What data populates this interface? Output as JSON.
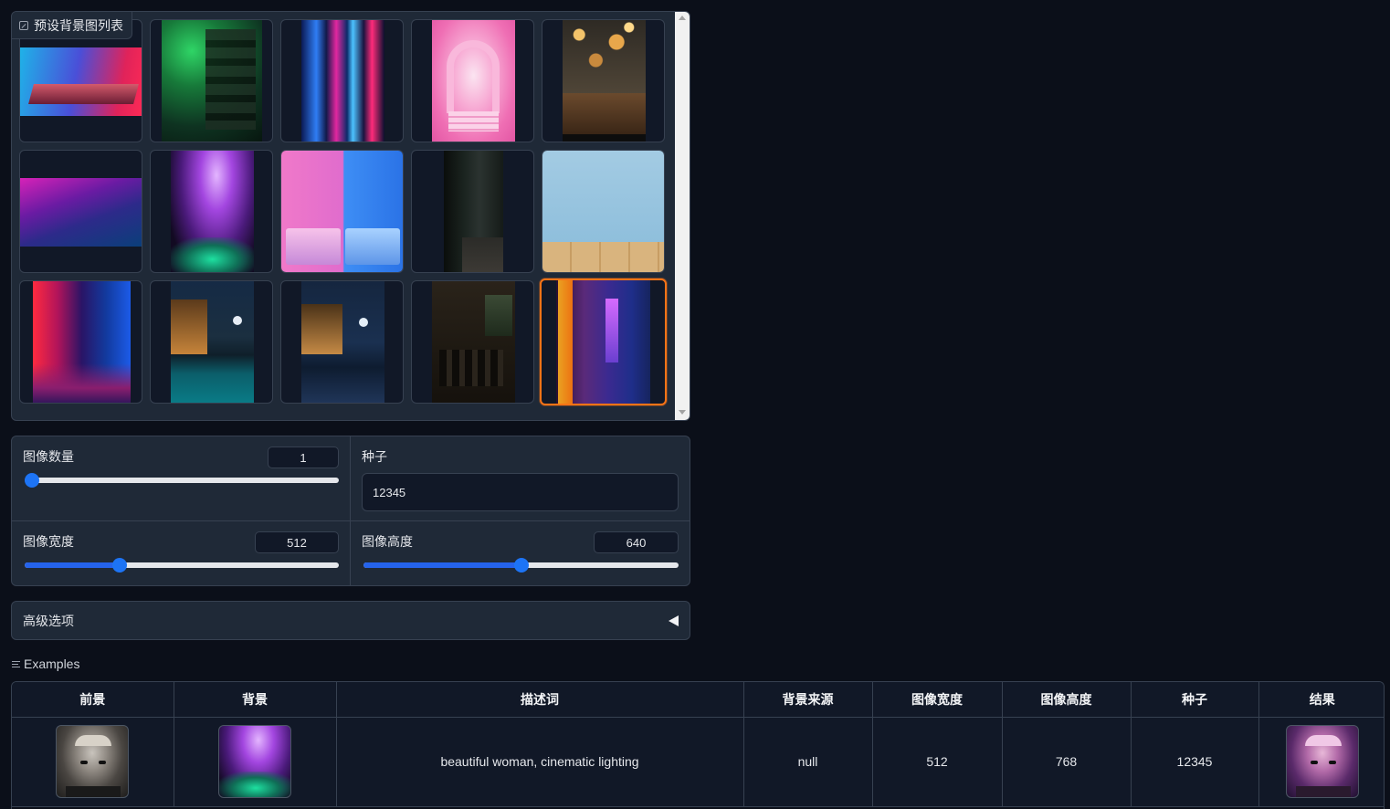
{
  "gallery": {
    "label": "预设背景图列表",
    "icon": "gallery-icon",
    "selected_index": 14,
    "items": [
      {
        "name": "blue-red-table-stage"
      },
      {
        "name": "green-dungeon-shelves"
      },
      {
        "name": "neon-light-streaks"
      },
      {
        "name": "pink-cloud-arch"
      },
      {
        "name": "bokeh-wood-table"
      },
      {
        "name": "purple-smoke-horizon"
      },
      {
        "name": "purple-spotlight-smoke"
      },
      {
        "name": "pink-blue-bedroom"
      },
      {
        "name": "dark-corridor"
      },
      {
        "name": "light-blue-wall-wood-floor"
      },
      {
        "name": "neon-city-street"
      },
      {
        "name": "night-terrace-pool"
      },
      {
        "name": "moonlit-beach-cabin"
      },
      {
        "name": "dark-restaurant"
      },
      {
        "name": "neon-skyline-window"
      }
    ]
  },
  "settings": {
    "image_count": {
      "label": "图像数量",
      "value": "1",
      "min": 1,
      "max": 50,
      "current": 1
    },
    "seed": {
      "label": "种子",
      "value": "12345"
    },
    "image_width": {
      "label": "图像宽度",
      "value": "512",
      "min": 64,
      "max": 1600,
      "current": 512
    },
    "image_height": {
      "label": "图像高度",
      "value": "640",
      "min": 64,
      "max": 1216,
      "current": 640
    }
  },
  "advanced": {
    "label": "高级选项",
    "icon": "collapse-triangle-icon"
  },
  "examples": {
    "label": "Examples",
    "icon": "list-icon",
    "headers": [
      "前景",
      "背景",
      "描述词",
      "背景来源",
      "图像宽度",
      "图像高度",
      "种子",
      "结果"
    ],
    "rows": [
      {
        "prompt": "beautiful woman, cinematic lighting",
        "bg_source": "null",
        "width": "512",
        "height": "768",
        "seed": "12345"
      }
    ]
  },
  "colors": {
    "page_bg": "#0b0f19",
    "panel_bg": "#1f2937",
    "border": "#374151",
    "accent": "#1d74f5",
    "selected": "#f97316"
  }
}
